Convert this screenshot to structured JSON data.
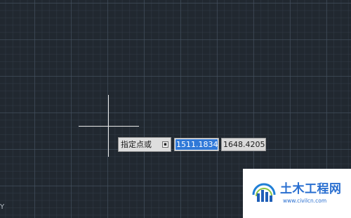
{
  "canvas": {
    "background_color": "#212830",
    "grid_color": "#465260"
  },
  "crosshair_cursor": {
    "color": "#e8e8e8"
  },
  "dynamic_input": {
    "prompt_label": "指定点或",
    "prompt_options_glyph": "▪",
    "x_value": "1511.1834",
    "y_value": "1648.4205",
    "highlight_color": "#3079d8"
  },
  "ucs": {
    "axis_label": "Y"
  },
  "watermark": {
    "title": "土木工程网",
    "url": "www.civilcn.com",
    "brand_color": "#2a6fd0"
  }
}
